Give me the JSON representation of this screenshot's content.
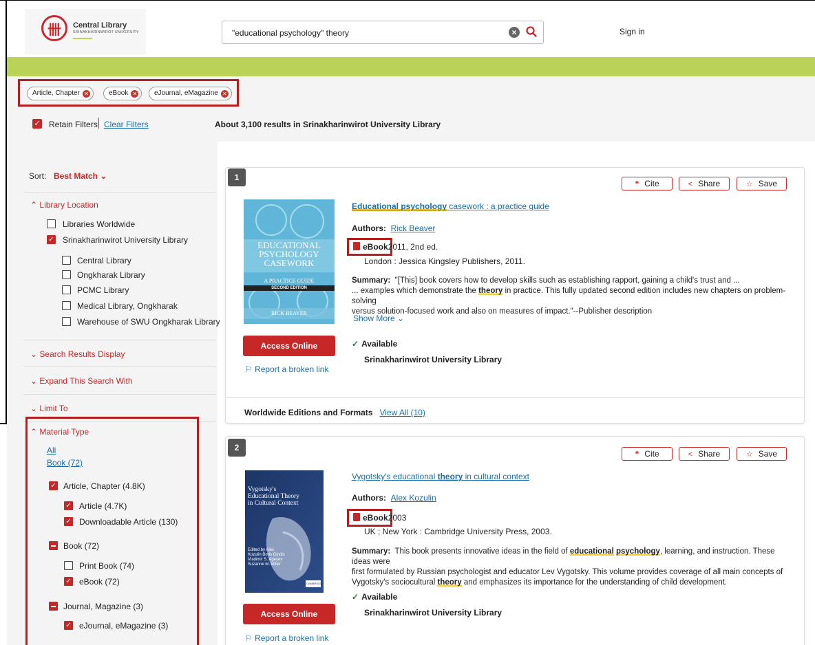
{
  "header": {
    "logo_title": "Central Library",
    "logo_subtitle": "SRINAKHARINWIROT UNIVERSITY",
    "search_value": "\"educational psychology\" theory",
    "signin": "Sign in"
  },
  "chips": [
    "Article, Chapter",
    "eBook",
    "eJournal, eMagazine"
  ],
  "filters": {
    "retain": "Retain Filters",
    "clear": "Clear Filters",
    "results_count": "About 3,100 results in Srinakharinwirot University Library"
  },
  "sidebar": {
    "sort_label": "Sort:",
    "sort_value": "Best Match",
    "library_location": "Library Location",
    "locations": [
      "Libraries Worldwide",
      "Srinakharinwirot University Library"
    ],
    "sub_locations": [
      "Central Library",
      "Ongkharak Library",
      "PCMC Library",
      "Medical Library, Ongkharak",
      "Warehouse of SWU Ongkharak Library"
    ],
    "search_results_display": "Search Results Display",
    "expand_search": "Expand This Search With",
    "limit_to": "Limit To",
    "material_type": "Material Type",
    "all": "All",
    "book_link": "Book (72)",
    "mt_article_chapter": "Article, Chapter (4.8K)",
    "mt_article": "Article (4.7K)",
    "mt_downloadable": "Downloadable Article (130)",
    "mt_book": "Book (72)",
    "mt_print_book": "Print Book (74)",
    "mt_ebook": "eBook (72)",
    "mt_journal": "Journal, Magazine (3)",
    "mt_ejournal": "eJournal, eMagazine (3)"
  },
  "buttons": {
    "cite": "Cite",
    "share": "Share",
    "save": "Save"
  },
  "results": [
    {
      "num": "1",
      "title_pre": "",
      "title_hl1": "Educational psychology",
      "title_post": " casework : a practice guide",
      "authors_label": "Authors:",
      "author": "Rick Beaver",
      "format": "eBook",
      "year": "2011, 2nd ed.",
      "publisher": "London : Jessica Kingsley Publishers, 2011.",
      "summary_label": "Summary:",
      "summary_line1": "\"[This] book covers how to develop skills such as establishing rapport, gaining a child's trust and ...",
      "summary_line2_pre": "... examples which demonstrate the ",
      "summary_line2_hl": "theory",
      "summary_line2_post": " in practice. This fully updated second edition includes new chapters on problem-solving",
      "summary_line3": "versus solution-focused work and also on measures of impact.\"--Publisher description",
      "show_more": "Show More",
      "cover_title": "EDUCATIONAL PSYCHOLOGY CASEWORK",
      "cover_sub": "A PRACTICE GUIDE",
      "cover_edition": "SECOND EDITION",
      "cover_author": "RICK BEAVER",
      "access": "Access Online",
      "report": "Report a broken link",
      "available": "Available",
      "library": "Srinakharinwirot University Library",
      "editions_label": "Worldwide Editions and Formats",
      "editions_link": "View All (10)"
    },
    {
      "num": "2",
      "title_pre": "Vygotsky's educational ",
      "title_hl1": "theory",
      "title_post": " in cultural context",
      "authors_label": "Authors:",
      "author": "Alex Kozulin",
      "format": "eBook",
      "year": "2003",
      "publisher": "UK ; New York : Cambridge University Press, 2003.",
      "summary_label": "Summary:",
      "summary_line1_pre": "This book presents innovative ideas in the field of ",
      "summary_line1_hl1": "educational",
      "summary_line1_hl2": "psychology",
      "summary_line1_post": ", learning, and instruction. These ideas were",
      "summary_line2": "first formulated by Russian psychologist and educator Lev Vygotsky. This volume provides coverage of all main concepts of",
      "summary_line3_pre": "Vygotsky's sociocultural ",
      "summary_line3_hl": "theory",
      "summary_line3_post": " and emphasizes its importance for the understanding of child development.",
      "cover_title": "Vygotsky's Educational Theory in Cultural Context",
      "cover_editors": "Edited by Alex Kozulin Boris Gindis Vladimir S. Ageyev Suzanne M. Miller",
      "cover_publisher": "CAMBRIDGE",
      "access": "Access Online",
      "report": "Report a broken link",
      "available": "Available",
      "library": "Srinakharinwirot University Library"
    }
  ]
}
